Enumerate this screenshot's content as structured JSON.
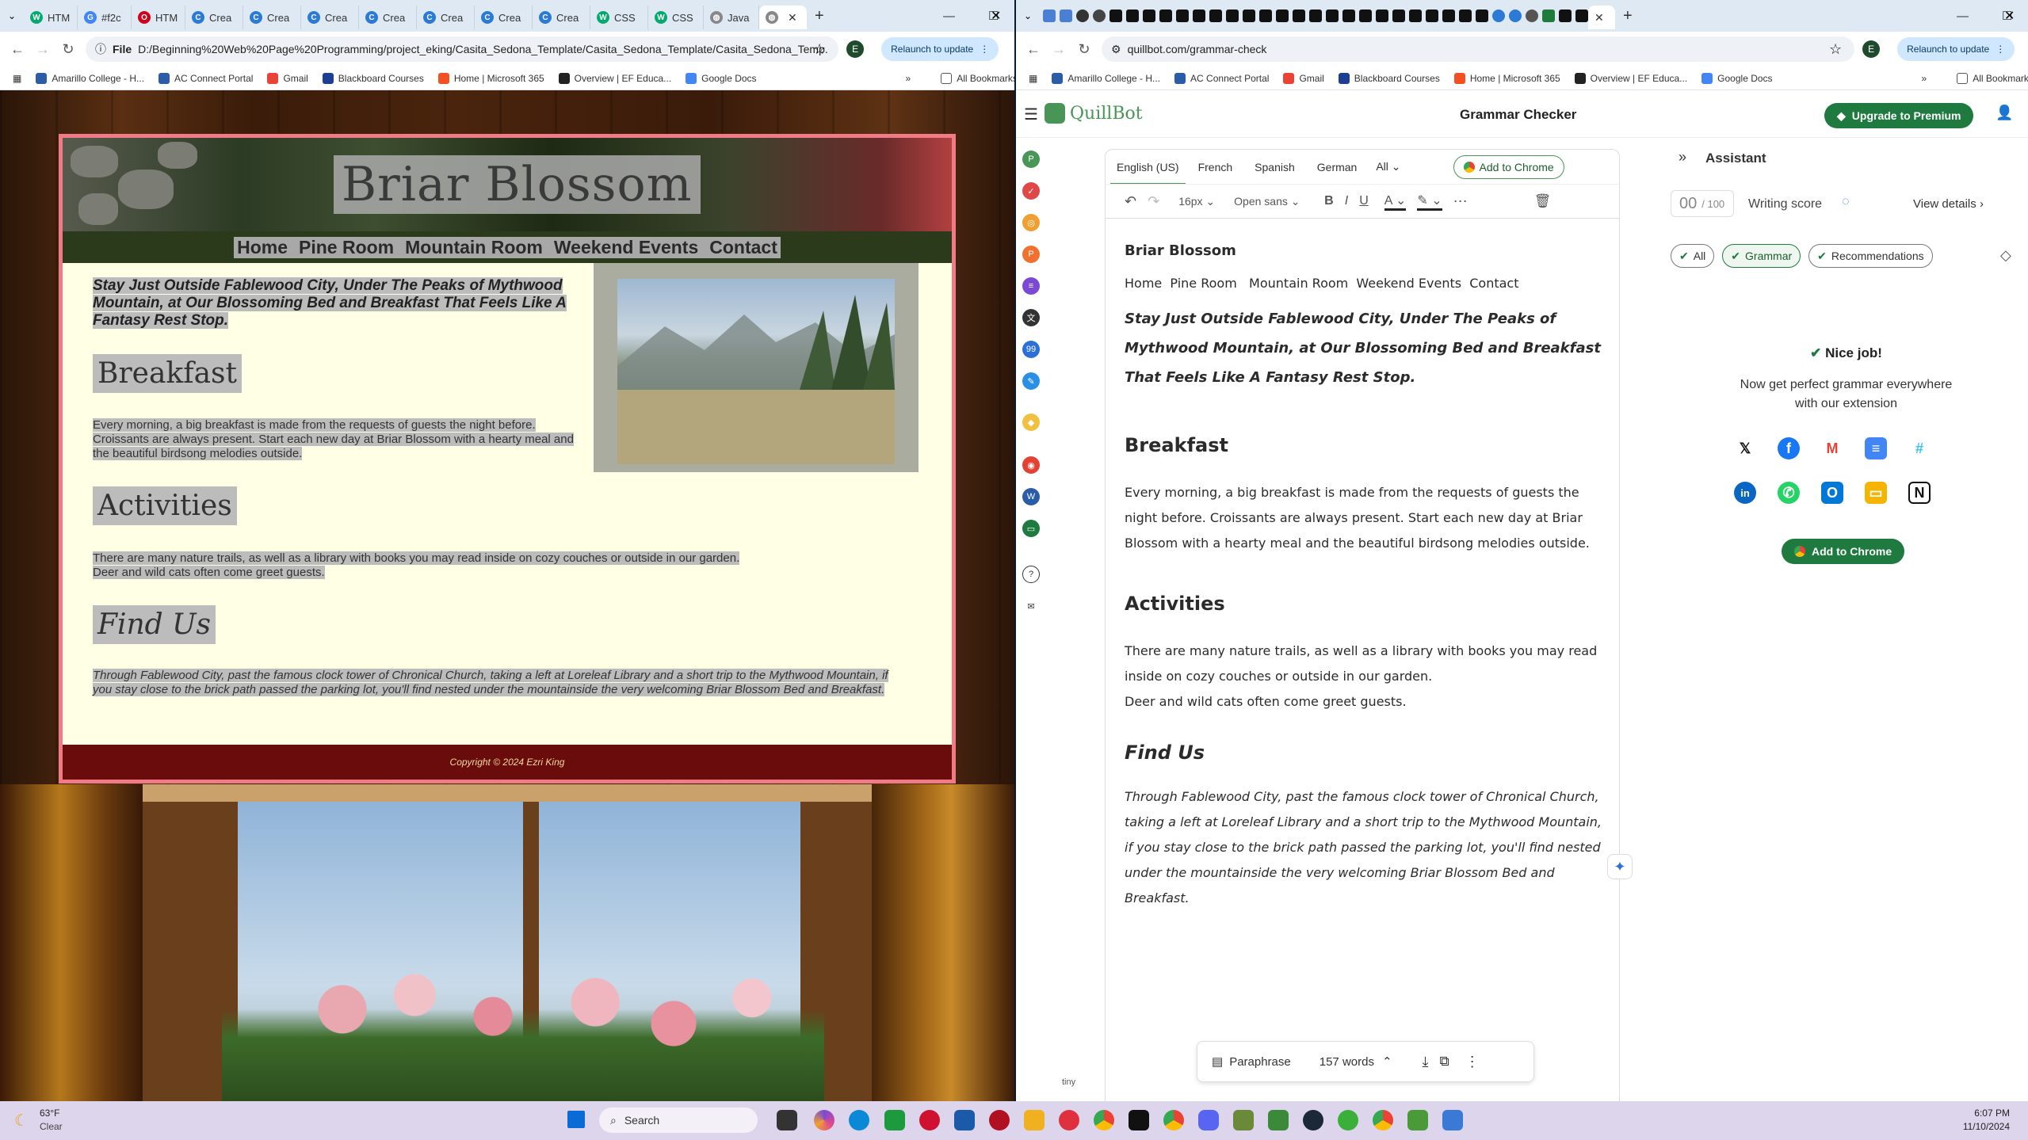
{
  "left_window": {
    "tabs": [
      "HTM",
      "#f2c",
      "HTM",
      "Crea",
      "Crea",
      "Crea",
      "Crea",
      "Crea",
      "Crea",
      "Crea",
      "CSS",
      "CSS",
      "Java",
      ""
    ],
    "url_prefix": "File",
    "url": "D:/Beginning%20Web%20Page%20Programming/project_eking/Casita_Sedona_Template/Casita_Sedona_Template/Casita_Sedona_Temp...",
    "relaunch": "Relaunch to update",
    "profile": "E"
  },
  "right_window": {
    "url": "quillbot.com/grammar-check",
    "relaunch": "Relaunch to update",
    "profile": "E"
  },
  "bookmarks": [
    "Amarillo College - H...",
    "AC Connect Portal",
    "Gmail",
    "Blackboard Courses",
    "Home | Microsoft 365",
    "Overview | EF Educa...",
    "Google Docs"
  ],
  "all_bookmarks": "All Bookmarks",
  "site": {
    "title": "Briar Blossom",
    "nav": [
      "Home",
      "Pine Room",
      "Mountain Room",
      "Weekend Events",
      "Contact"
    ],
    "intro": "Stay Just Outside Fablewood City, Under The Peaks of Mythwood Mountain, at Our Blossoming Bed and Breakfast That Feels Like A Fantasy Rest Stop.",
    "breakfast_heading": "Breakfast",
    "breakfast_text": "Every morning, a big breakfast is made from the requests of guests the night before. Croissants are always present. Start each new day at Briar Blossom with a hearty meal and the beautiful birdsong melodies outside.",
    "activities_heading": "Activities",
    "activities_text_1": "There are many nature trails, as well as a library with books you may read inside on cozy couches or outside in our garden.",
    "activities_text_2": "Deer and wild cats often come greet guests.",
    "find_heading": "Find Us",
    "find_text": "Through Fablewood City, past the famous clock tower of Chronical Church, taking a left at Loreleaf Library and a short trip to the Mythwood Mountain, if you stay close to the brick path passed the parking lot, you'll find nested under the mountainside the very welcoming Briar Blossom Bed and Breakfast.",
    "footer": "Copyright © 2024 Ezri King"
  },
  "quillbot": {
    "brand": "QuillBot",
    "page_title": "Grammar Checker",
    "upgrade": "Upgrade to Premium",
    "languages": [
      "English (US)",
      "French",
      "Spanish",
      "German",
      "All"
    ],
    "add_to_chrome": "Add to Chrome",
    "font_size": "16px",
    "font_family": "Open sans",
    "editor": {
      "title": "Briar Blossom",
      "nav": "Home  Pine Room   Mountain Room  Weekend Events  Contact",
      "intro": "Stay Just Outside Fablewood City, Under The Peaks of Mythwood Mountain, at Our Blossoming Bed and Breakfast That Feels Like A Fantasy Rest Stop.",
      "h_breakfast": "Breakfast",
      "p_breakfast": "Every morning, a big breakfast is made from the requests of guests the night before. Croissants are always present. Start each new day at Briar Blossom with a hearty meal and the beautiful birdsong melodies outside.",
      "h_activities": "Activities",
      "p_activities_1": "There are many nature trails, as well as a library with books you may read inside on cozy couches or outside in our garden.",
      "p_activities_2": "Deer and wild cats often come greet guests.",
      "h_find": "Find Us",
      "p_find": "Through Fablewood City, past the famous clock tower of Chronical Church, taking a left at Loreleaf Library and a short trip to the Mythwood Mountain, if you stay close to the brick path passed the parking lot, you'll find nested under the mountainside the very welcoming Briar Blossom Bed and Breakfast."
    },
    "bottom_bar": {
      "paraphrase": "Paraphrase",
      "words": "157 words"
    },
    "tiny": "tiny",
    "assistant": {
      "label": "Assistant",
      "score_value": "00",
      "score_max": "/ 100",
      "score_label": "Writing score",
      "view_details": "View details",
      "filters": [
        "All",
        "Grammar",
        "Recommendations"
      ],
      "nice_job": "Nice job!",
      "promo": "Now get perfect grammar everywhere with our extension",
      "add_to_chrome": "Add to Chrome"
    }
  },
  "taskbar": {
    "weather_temp": "63°F",
    "weather_desc": "Clear",
    "search": "Search",
    "time": "6:07 PM",
    "date": "11/10/2024"
  }
}
